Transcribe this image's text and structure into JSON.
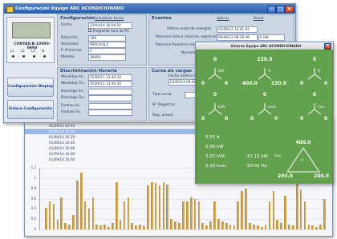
{
  "main_window": {
    "title": "Configuración Equipo ARC ACONDICIONADO",
    "device": {
      "name": "CONTAX-B-10093-0693",
      "port_labels": [
        "L1",
        "L2",
        "L3",
        "N"
      ]
    },
    "side_buttons": [
      "Configuración Display",
      "Enlace Configuración"
    ],
    "configuracion": {
      "title": "Configuración",
      "top_link": "Actualizar fecha",
      "fields": [
        {
          "label": "Fecha",
          "value": "23/04/14 10:04:52"
        },
        {
          "label": "Dirección",
          "value": "189"
        },
        {
          "label": "Velocidad",
          "value": "9600,8,N,1"
        },
        {
          "label": "P. Primarios",
          "value": "0"
        },
        {
          "label": "Modelo",
          "value": "10093"
        }
      ],
      "checkbox_label": "Programar hora del PC"
    },
    "eventos": {
      "title": "Eventos",
      "fields": [
        {
          "label": "Último reset de energías",
          "value": "03/09/12 13:01:42"
        },
        {
          "label": "Potencia Activa máxima registrada",
          "value": "09/08/12 08:30:46"
        },
        {
          "label": "Potencia Reactiva máxima registrada",
          "value": ""
        },
        {
          "label": "Número de",
          "value": ""
        }
      ],
      "extra_value": "0 kW",
      "top_links": [
        "Aplicar",
        "Reset"
      ]
    },
    "discriminacion": {
      "title": "Discriminación Horaria",
      "rows": [
        {
          "label": "Weekday Ini.",
          "value": "01/09/11 13:40:33"
        },
        {
          "label": "Weekday Fin.",
          "value": "01/09/11 13:40:33"
        },
        {
          "label": "Domingo Ini.",
          "value": ""
        },
        {
          "label": "Domingo Fin.",
          "value": ""
        },
        {
          "label": "Festivo Ini.",
          "value": ""
        },
        {
          "label": "Festivo Fin.",
          "value": ""
        }
      ]
    },
    "curva": {
      "title": "Curva de cargas",
      "field_label": "Fecha último registro",
      "field_value": "23/04/14 09:40",
      "tipo_label": "Tipo curva",
      "registros_label": "N° Registros",
      "actual_label": "Reg. actual"
    }
  },
  "meter_window": {
    "title": "Valores Equipo ARC ACONDICIONADO",
    "phase_values": {
      "kw": "0",
      "voltage": "230.9",
      "current": "0",
      "kvar": "0",
      "kva": "0",
      "kvar2": "0",
      "pf": "0"
    },
    "phase_labels": {
      "kw": "kW",
      "voltage": "V",
      "current": "A",
      "kva": "kVA",
      "kvar": "kvar",
      "pf": "Cos"
    },
    "triangle_values": {
      "kw_left": "0",
      "kw_right": "0",
      "v_left": "400.0",
      "v_right": "230.9",
      "a_left": "0",
      "a_right": "0",
      "kva_left": "0",
      "kva_right": "0",
      "kvar_left": "0",
      "kvar_right": "0",
      "pf_left": "0",
      "pf_right": "0"
    },
    "summary": [
      "0.55 A",
      "0.06 kW",
      "0.07 kVA",
      "0.00 kvar"
    ],
    "summary_mid": [
      "97.15 kW",
      "50.02 Hz"
    ],
    "summary_mid_label": "Cos",
    "big_triangle": {
      "top": "400.0",
      "unit": "V",
      "left": "200.0",
      "right": "200.0"
    }
  },
  "list_window": {
    "rows": [
      "01/09/14 00:40",
      "01/09/14 10:00",
      "01/09/14 10:20",
      "01/09/14 10:40",
      "01/09/14 10:00",
      "01/09/14 10:00",
      "01/09/14 10:00"
    ]
  },
  "chart_data": {
    "type": "bar",
    "ylim": [
      0,
      1.2
    ],
    "yticks": [
      "1.2",
      "1",
      "0.8",
      "0.6",
      "0.4",
      "0.2",
      "0"
    ],
    "values": [
      0,
      0.42,
      0.55,
      0.5,
      0.18,
      0.62,
      0.12,
      0.1,
      0.28,
      0.95,
      1.1,
      0.55,
      0.4,
      0.62,
      0.1,
      0.08,
      0.1,
      0.05,
      0.12,
      0.92,
      0.18,
      0.55,
      0.62,
      0.12,
      0.08,
      0.1,
      0.06,
      0.85,
      0.92,
      0.9,
      0.85,
      0.92,
      0.88,
      0.2,
      0.15,
      0.12,
      0.55,
      0.55,
      0.62,
      0.6,
      0.55,
      0.12,
      0.08,
      0.15,
      0.55,
      0.2,
      0.15,
      0.12,
      0.1,
      0.08,
      0.55,
      0.75,
      0.8,
      0.12,
      0.1,
      0.08,
      0.05,
      0.1,
      0.55,
      0.75,
      0.18,
      0.12,
      0.65,
      0.1,
      0.08,
      0.9,
      0.78,
      0.55,
      0.1,
      0.08,
      0.05,
      0.1,
      0.6
    ],
    "grid": true
  }
}
